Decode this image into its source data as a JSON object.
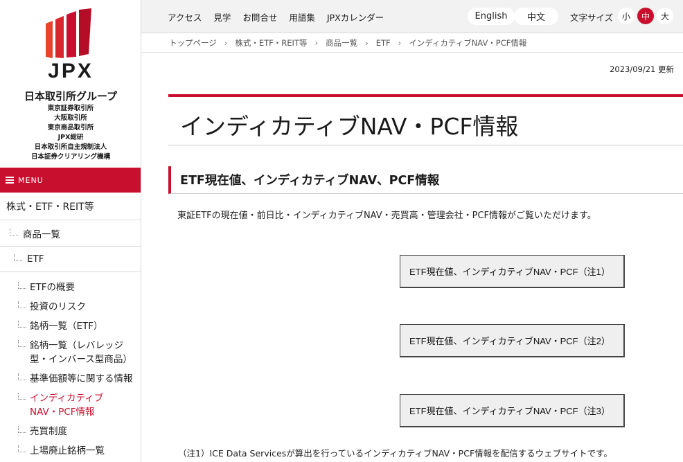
{
  "logo": {
    "text": "JPX",
    "group": "日本取引所グループ",
    "companies": [
      "東京証券取引所",
      "大阪取引所",
      "東京商品取引所",
      "JPX総研",
      "日本取引所自主規制法人",
      "日本証券クリアリング機構"
    ]
  },
  "sidebar": {
    "menu_label": "MENU",
    "top_item": "株式・ETF・REIT等",
    "level1": "商品一覧",
    "level2": "ETF",
    "items": [
      {
        "label": "ETFの概要"
      },
      {
        "label": "投資のリスク"
      },
      {
        "label": "銘柄一覧（ETF）"
      },
      {
        "label": "銘柄一覧（レバレッジ型・インバース型商品）"
      },
      {
        "label": "基準価額等に関する情報"
      },
      {
        "label": "インディカティブNAV・PCF情報"
      },
      {
        "label": "売買制度"
      },
      {
        "label": "上場廃止銘柄一覧"
      }
    ]
  },
  "header": {
    "nav": [
      "アクセス",
      "見学",
      "お問合せ",
      "用語集",
      "JPXカレンダー"
    ],
    "lang_en": "English",
    "lang_zh": "中文",
    "font_size_label": "文字サイズ",
    "font_sizes": [
      "小",
      "中",
      "大"
    ]
  },
  "breadcrumb": [
    "トップページ",
    "株式・ETF・REIT等",
    "商品一覧",
    "ETF",
    "インディカティブNAV・PCF情報"
  ],
  "breadcrumb_sep": "›",
  "updated": "2023/09/21 更新",
  "page_title": "インディカティブNAV・PCF情報",
  "section_title": "ETF現在値、インディカティブNAV、PCF情報",
  "description": "東証ETFの現在値・前日比・インディカティブNAV・売買高・管理会社・PCF情報がご覧いただけます。",
  "buttons": [
    "ETF現在値、インディカティブNAV・PCF（注1）",
    "ETF現在値、インディカティブNAV・PCF（注2）",
    "ETF現在値、インディカティブNAV・PCF（注3）"
  ],
  "note1": "（注1）ICE Data Servicesが算出を行っているインディカティブNAV・PCF情報を配信するウェブサイトです。",
  "colors": {
    "accent": "#c8102e"
  }
}
